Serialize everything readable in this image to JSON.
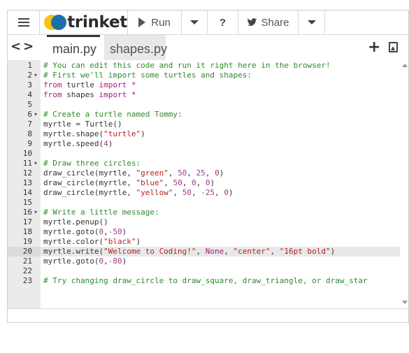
{
  "toolbar": {
    "brand": "trinket",
    "run_label": "Run",
    "help_label": "?",
    "share_label": "Share"
  },
  "tabs": [
    {
      "label": "main.py",
      "active": true
    },
    {
      "label": "shapes.py",
      "active": false
    }
  ],
  "icons": {
    "menu": "hamburger-menu-icon",
    "logo": "trinket-logo-icon",
    "run": "play-icon",
    "caret": "chevron-down-icon",
    "share": "twitter-bird-icon",
    "nav": "code-arrows-icon",
    "add": "plus-icon",
    "image": "image-file-icon"
  },
  "colors": {
    "comment": "#2d8a2d",
    "keyword": "#b5138f",
    "string": "#b81f1f",
    "number": "#9e3d8a",
    "brand_yellow": "#f5c311",
    "brand_blue": "#1e6fa8"
  },
  "editor": {
    "highlighted_line": 20,
    "lines": [
      {
        "n": "1",
        "fold": false,
        "tokens": [
          [
            "cm",
            "# You can edit this code and run it right here in the browser!"
          ]
        ]
      },
      {
        "n": "2",
        "fold": true,
        "tokens": [
          [
            "cm",
            "# First we'll import some turtles and shapes:"
          ]
        ]
      },
      {
        "n": "3",
        "fold": false,
        "tokens": [
          [
            "kw",
            "from"
          ],
          [
            "tx",
            " turtle "
          ],
          [
            "kw",
            "import"
          ],
          [
            "tx",
            " "
          ],
          [
            "kw",
            "*"
          ]
        ]
      },
      {
        "n": "4",
        "fold": false,
        "tokens": [
          [
            "kw",
            "from"
          ],
          [
            "tx",
            " shapes "
          ],
          [
            "kw",
            "import"
          ],
          [
            "tx",
            " "
          ],
          [
            "kw",
            "*"
          ]
        ]
      },
      {
        "n": "5",
        "fold": false,
        "tokens": []
      },
      {
        "n": "6",
        "fold": true,
        "tokens": [
          [
            "cm",
            "# Create a turtle named Tommy:"
          ]
        ]
      },
      {
        "n": "7",
        "fold": false,
        "tokens": [
          [
            "tx",
            "myrtle = Turtle()"
          ]
        ]
      },
      {
        "n": "8",
        "fold": false,
        "tokens": [
          [
            "tx",
            "myrtle.shape("
          ],
          [
            "st",
            "\"turtle\""
          ],
          [
            "tx",
            ")"
          ]
        ]
      },
      {
        "n": "9",
        "fold": false,
        "tokens": [
          [
            "tx",
            "myrtle.speed("
          ],
          [
            "nm",
            "4"
          ],
          [
            "tx",
            ")"
          ]
        ]
      },
      {
        "n": "10",
        "fold": false,
        "tokens": []
      },
      {
        "n": "11",
        "fold": true,
        "tokens": [
          [
            "cm",
            "# Draw three circles:"
          ]
        ]
      },
      {
        "n": "12",
        "fold": false,
        "tokens": [
          [
            "tx",
            "draw_circle(myrtle, "
          ],
          [
            "st",
            "\"green\""
          ],
          [
            "tx",
            ", "
          ],
          [
            "nm",
            "50"
          ],
          [
            "tx",
            ", "
          ],
          [
            "nm",
            "25"
          ],
          [
            "tx",
            ", "
          ],
          [
            "nm",
            "0"
          ],
          [
            "tx",
            ")"
          ]
        ]
      },
      {
        "n": "13",
        "fold": false,
        "tokens": [
          [
            "tx",
            "draw_circle(myrtle, "
          ],
          [
            "st",
            "\"blue\""
          ],
          [
            "tx",
            ", "
          ],
          [
            "nm",
            "50"
          ],
          [
            "tx",
            ", "
          ],
          [
            "nm",
            "0"
          ],
          [
            "tx",
            ", "
          ],
          [
            "nm",
            "0"
          ],
          [
            "tx",
            ")"
          ]
        ]
      },
      {
        "n": "14",
        "fold": false,
        "tokens": [
          [
            "tx",
            "draw_circle(myrtle, "
          ],
          [
            "st",
            "\"yellow\""
          ],
          [
            "tx",
            ", "
          ],
          [
            "nm",
            "50"
          ],
          [
            "tx",
            ", "
          ],
          [
            "nm",
            "-25"
          ],
          [
            "tx",
            ", "
          ],
          [
            "nm",
            "0"
          ],
          [
            "tx",
            ")"
          ]
        ]
      },
      {
        "n": "15",
        "fold": false,
        "tokens": []
      },
      {
        "n": "16",
        "fold": true,
        "tokens": [
          [
            "cm",
            "# Write a little message:"
          ]
        ]
      },
      {
        "n": "17",
        "fold": false,
        "tokens": [
          [
            "tx",
            "myrtle.penup()"
          ]
        ]
      },
      {
        "n": "18",
        "fold": false,
        "tokens": [
          [
            "tx",
            "myrtle.goto("
          ],
          [
            "nm",
            "0"
          ],
          [
            "tx",
            ","
          ],
          [
            "nm",
            "-50"
          ],
          [
            "tx",
            ")"
          ]
        ]
      },
      {
        "n": "19",
        "fold": false,
        "tokens": [
          [
            "tx",
            "myrtle.color("
          ],
          [
            "st",
            "\"black\""
          ],
          [
            "tx",
            ")"
          ]
        ]
      },
      {
        "n": "20",
        "fold": false,
        "tokens": [
          [
            "tx",
            "myrtle.write("
          ],
          [
            "st",
            "\"Welcome to Coding!\""
          ],
          [
            "tx",
            ", "
          ],
          [
            "kw",
            "None"
          ],
          [
            "tx",
            ", "
          ],
          [
            "st",
            "\"center\""
          ],
          [
            "tx",
            ", "
          ],
          [
            "st",
            "\"16pt bold\""
          ],
          [
            "tx",
            ")"
          ]
        ]
      },
      {
        "n": "21",
        "fold": false,
        "tokens": [
          [
            "tx",
            "myrtle.goto("
          ],
          [
            "nm",
            "0"
          ],
          [
            "tx",
            ","
          ],
          [
            "nm",
            "-80"
          ],
          [
            "tx",
            ")"
          ]
        ]
      },
      {
        "n": "22",
        "fold": false,
        "tokens": []
      },
      {
        "n": "23",
        "fold": false,
        "tokens": [
          [
            "cm",
            "# Try changing draw_circle to draw_square, draw_triangle, or draw_star"
          ]
        ]
      }
    ]
  }
}
